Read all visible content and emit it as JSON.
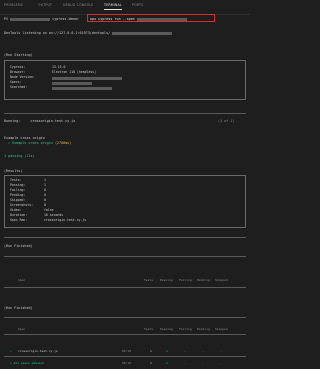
{
  "tabs": [
    "PROBLEMS",
    "OUTPUT",
    "DEBUG CONSOLE",
    "TERMINAL",
    "PORTS"
  ],
  "active_tab": "TERMINAL",
  "terminal": {
    "prompt_prefix": "PS",
    "prompt_path": "cypress-demo>",
    "command": "npx cypress run --spec",
    "devtools_line": "DevTools listening on ws://127.0.0.1:61973/devtools/",
    "run_starting": "(Run Starting)",
    "env": [
      {
        "k": "Cypress:",
        "v": "13.15.0"
      },
      {
        "k": "Browser:",
        "v": "Electron 118 (headless)"
      },
      {
        "k": "Node Version:",
        "v": ""
      },
      {
        "k": "Specs:",
        "v": ""
      },
      {
        "k": "Searched:",
        "v": ""
      }
    ],
    "running_label": "Running:",
    "running_file": "crossorigin.test.cy.js",
    "running_count": "(1 of 1)",
    "describe": "Example cross origin",
    "test_ok_prefix": "✓ Example cross origin",
    "test_time": "(2768ms)",
    "passing": "1 passing (11s)",
    "results_label": "(Results)",
    "results": [
      {
        "k": "Tests:",
        "v": "1"
      },
      {
        "k": "Passing:",
        "v": "1"
      },
      {
        "k": "Failing:",
        "v": "0"
      },
      {
        "k": "Pending:",
        "v": "0"
      },
      {
        "k": "Skipped:",
        "v": "0"
      },
      {
        "k": "Screenshots:",
        "v": "0"
      },
      {
        "k": "Video:",
        "v": "false"
      },
      {
        "k": "Duration:",
        "v": "10 seconds"
      },
      {
        "k": "Spec Ran:",
        "v": "crossorigin.test.cy.js"
      }
    ],
    "run_finished_1": "(Run Finished)",
    "run_finished_2": "(Run Finished)",
    "table_cols": [
      "Spec",
      "Tests",
      "Passing",
      "Failing",
      "Pending",
      "Skipped"
    ],
    "row": {
      "check": "✓",
      "spec": "crossorigin.test.cy.js",
      "time": "00:10",
      "tests": "1",
      "passing": "1",
      "failing": "-",
      "pending": "-",
      "skipped": "-"
    },
    "summary": {
      "text": "✓ All specs passed!",
      "time": "00:10",
      "tests": "1",
      "passing": "1",
      "failing": "-",
      "pending": "-",
      "skipped": "-"
    }
  }
}
